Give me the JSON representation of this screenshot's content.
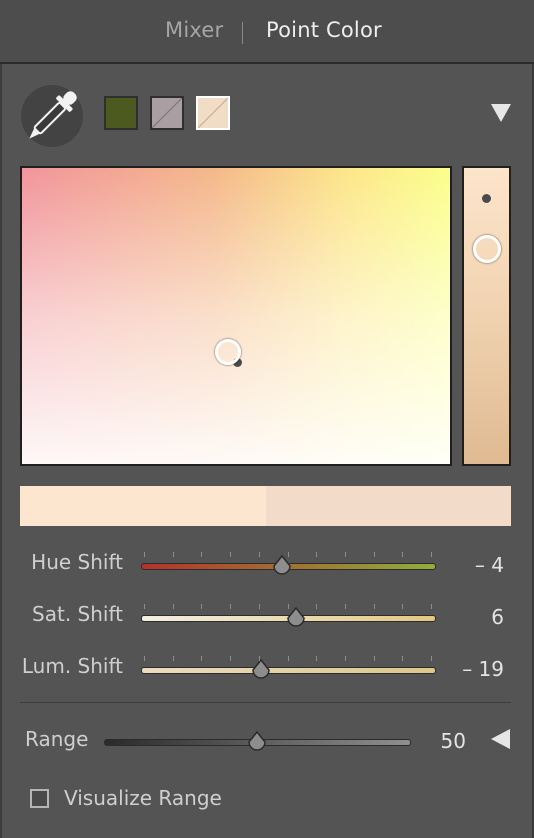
{
  "tabs": [
    {
      "label": "Mixer",
      "active": false
    },
    {
      "label": "Point Color",
      "active": true
    }
  ],
  "toolbar": {
    "picker_icon": "eyedropper-icon",
    "swatches": [
      {
        "color": "#4c5a1f",
        "selected": false
      },
      {
        "color": "#a99ea2",
        "selected": false
      },
      {
        "color": "#f1dcc5",
        "selected": true
      }
    ],
    "menu_icon": "triangle-down-icon"
  },
  "color_field": {
    "gradient_colors": [
      "#f1959c",
      "#f4b88a",
      "#fce58a",
      "#fbff8a"
    ],
    "luminance_colors": [
      "#fde5cb",
      "#dfba92"
    ]
  },
  "preview": {
    "original_color": "#fde6d0",
    "adjusted_color": "#f2dcc9"
  },
  "sliders": [
    {
      "id": "hue",
      "label": "Hue Shift",
      "value": "– 4",
      "position_fraction": 0.48,
      "gradient": [
        "#b3332a",
        "#8fae3a"
      ]
    },
    {
      "id": "sat",
      "label": "Sat. Shift",
      "value": "6",
      "position_fraction": 0.53,
      "gradient": [
        "#f3efe3",
        "#e3c882"
      ]
    },
    {
      "id": "lum",
      "label": "Lum. Shift",
      "value": "– 19",
      "position_fraction": 0.41,
      "gradient": [
        "#e9dcc0",
        "#dcc78a"
      ]
    }
  ],
  "range": {
    "label": "Range",
    "value": "50",
    "position_fraction": 0.5,
    "collapse_icon": "triangle-left-icon"
  },
  "visualize": {
    "label": "Visualize Range",
    "checked": false
  }
}
